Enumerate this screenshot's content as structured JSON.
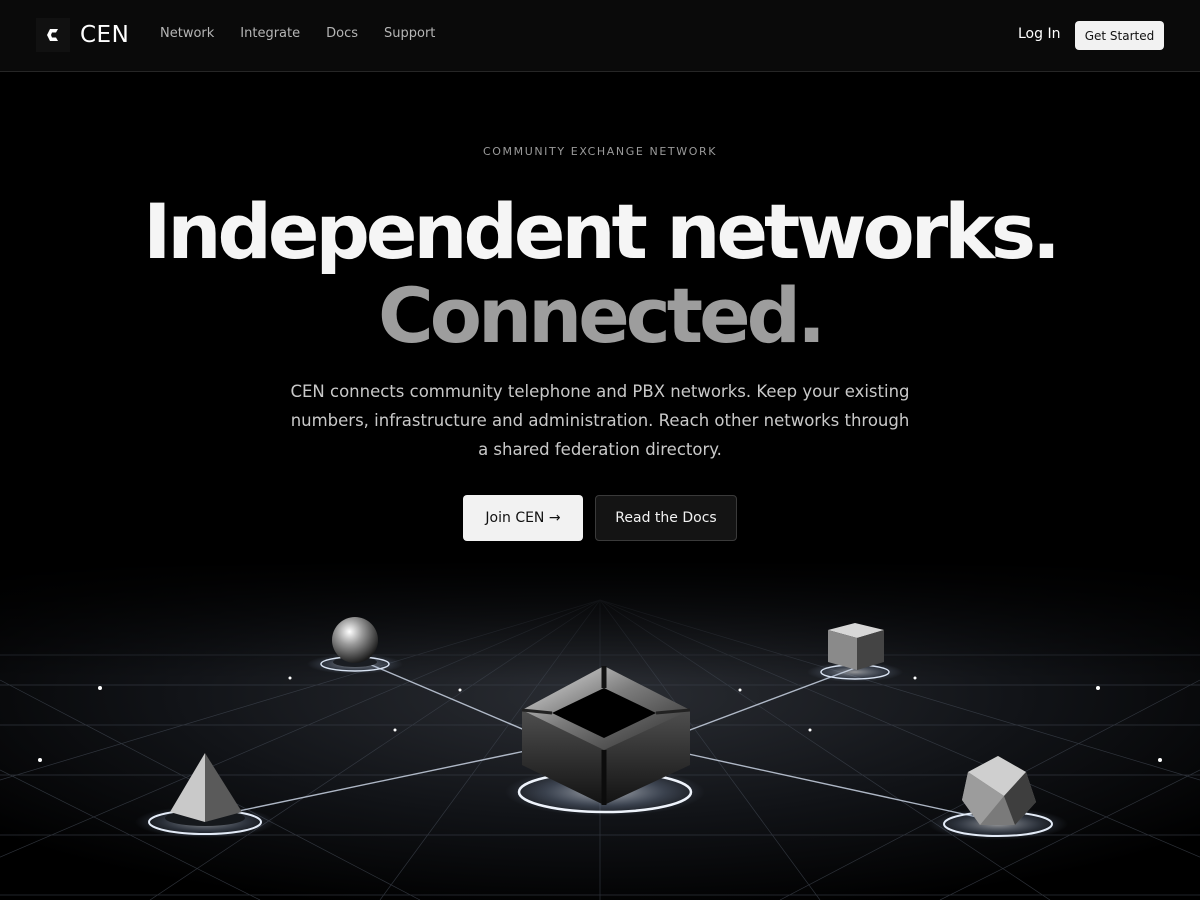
{
  "brand": {
    "name": "CEN",
    "logo_icon": "cen-c-logo-icon"
  },
  "nav": {
    "items": [
      {
        "label": "Network"
      },
      {
        "label": "Integrate"
      },
      {
        "label": "Docs"
      },
      {
        "label": "Support"
      }
    ],
    "login_label": "Log In",
    "get_started_label": "Get Started"
  },
  "hero": {
    "eyebrow": "COMMUNITY EXCHANGE NETWORK",
    "headline_line1": "Independent networks.",
    "headline_line2": "Connected.",
    "description": "CEN connects community telephone and PBX networks. Keep your existing numbers, infrastructure and administration. Reach other networks through a shared federation directory.",
    "primary_cta": "Join CEN →",
    "secondary_cta": "Read the Docs"
  },
  "illustration": {
    "icon": "network-federation-illustration",
    "nodes": [
      "sphere",
      "cube",
      "pyramid",
      "icosahedron",
      "hexagon-hub"
    ]
  },
  "colors": {
    "background": "#000000",
    "topbar": "#0a0a0a",
    "headline_primary": "#f5f5f5",
    "headline_secondary": "#9d9d9d",
    "button_light": "#f2f2f2"
  }
}
